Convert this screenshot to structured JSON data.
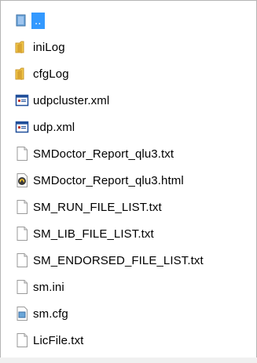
{
  "file_list": {
    "items": [
      {
        "label": "..",
        "icon": "parent-folder-icon",
        "selected": true
      },
      {
        "label": "iniLog",
        "icon": "folder-icon"
      },
      {
        "label": "cfgLog",
        "icon": "folder-icon"
      },
      {
        "label": "udpcluster.xml",
        "icon": "xml-file-icon"
      },
      {
        "label": "udp.xml",
        "icon": "xml-file-icon"
      },
      {
        "label": "SMDoctor_Report_qlu3.txt",
        "icon": "text-file-icon"
      },
      {
        "label": "SMDoctor_Report_qlu3.html",
        "icon": "html-file-icon"
      },
      {
        "label": "SM_RUN_FILE_LIST.txt",
        "icon": "text-file-icon"
      },
      {
        "label": "SM_LIB_FILE_LIST.txt",
        "icon": "text-file-icon"
      },
      {
        "label": "SM_ENDORSED_FILE_LIST.txt",
        "icon": "text-file-icon"
      },
      {
        "label": "sm.ini",
        "icon": "ini-file-icon"
      },
      {
        "label": "sm.cfg",
        "icon": "config-file-icon"
      },
      {
        "label": "LicFile.txt",
        "icon": "text-file-icon"
      }
    ]
  },
  "colors": {
    "selection": "#3399ff",
    "folder": "#e8b93a",
    "xml_icon": "#1f4e9a"
  }
}
